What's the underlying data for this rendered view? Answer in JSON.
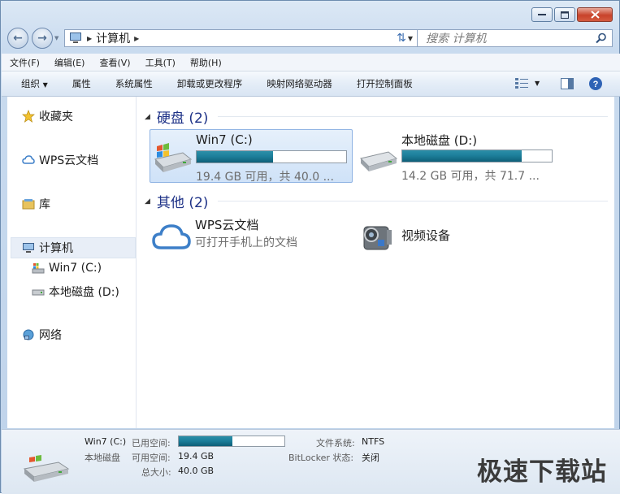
{
  "address": {
    "path_label": "计算机"
  },
  "search": {
    "placeholder": "搜索 计算机"
  },
  "menu": {
    "items": [
      "文件(F)",
      "编辑(E)",
      "查看(V)",
      "工具(T)",
      "帮助(H)"
    ]
  },
  "toolbar": {
    "organize": "组织",
    "properties": "属性",
    "system_properties": "系统属性",
    "uninstall": "卸载或更改程序",
    "map_drive": "映射网络驱动器",
    "control_panel": "打开控制面板"
  },
  "nav": {
    "favorites": "收藏夹",
    "wps": "WPS云文档",
    "library": "库",
    "computer": "计算机",
    "drive_c": "Win7 (C:)",
    "drive_d": "本地磁盘 (D:)",
    "network": "网络"
  },
  "content": {
    "hard_disks": {
      "title": "硬盘 (2)",
      "drives": [
        {
          "name": "Win7 (C:)",
          "usage": 0.51,
          "space": "19.4 GB 可用，共 40.0 ..."
        },
        {
          "name": "本地磁盘 (D:)",
          "usage": 0.8,
          "space": "14.2 GB 可用，共 71.7 ..."
        }
      ]
    },
    "other": {
      "title": "其他 (2)",
      "items": [
        {
          "name": "WPS云文档",
          "sub": "可打开手机上的文档"
        },
        {
          "name": "视频设备"
        }
      ]
    }
  },
  "details": {
    "name": "Win7 (C:)",
    "type": "本地磁盘",
    "used_label": "已用空间:",
    "used_fraction": 0.51,
    "free_label": "可用空间:",
    "free_value": "19.4 GB",
    "total_label": "总大小:",
    "total_value": "40.0 GB",
    "fs_label": "文件系统:",
    "fs_value": "NTFS",
    "bitlocker_label": "BitLocker 状态:",
    "bitlocker_value": "关闭"
  },
  "watermark": "极速下载站",
  "colors": {
    "accent": "#1e3287",
    "bar": "#1d7f9b",
    "selection": "#cfe2f8"
  }
}
